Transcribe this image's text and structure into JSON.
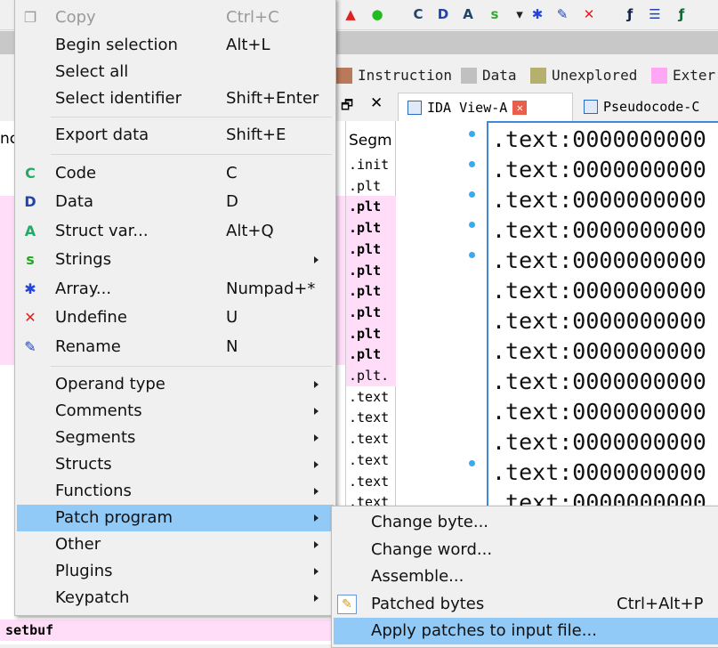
{
  "toolbar": {
    "icons": [
      "warning-icon",
      "green-circle-icon",
      "make-code-icon",
      "make-data-icon",
      "struct-var-icon",
      "strings-icon",
      "dropdown-icon",
      "array-icon",
      "rename-icon",
      "undefine-icon",
      "function-icon",
      "list-icon",
      "function-tail-icon"
    ]
  },
  "legend": [
    {
      "label": "Instruction",
      "color": "#b87a5a"
    },
    {
      "label": "Data",
      "color": "#c0c0c0"
    },
    {
      "label": "Unexplored",
      "color": "#b5b06e"
    },
    {
      "label": "Exter",
      "color": "#ffa6f4"
    }
  ],
  "tabs": [
    {
      "label": "IDA View-A"
    },
    {
      "label": "Pseudocode-C"
    }
  ],
  "left_panel": {
    "header_fragment": "nc",
    "bottom_row": "setbuf"
  },
  "segments": {
    "header": "Segm",
    "rows": [
      ".init",
      ".plt",
      ".plt",
      ".plt",
      ".plt",
      ".plt",
      ".plt",
      ".plt",
      ".plt",
      ".plt",
      ".plt.",
      ".text",
      ".text",
      ".text",
      ".text",
      ".text",
      ".text"
    ]
  },
  "ida_view": {
    "line_text": ".text:0000000000"
  },
  "context_menu": {
    "items": [
      {
        "label": "Copy",
        "shortcut": "Ctrl+C",
        "icon": "copy-icon",
        "disabled": true
      },
      {
        "label": "Begin selection",
        "shortcut": "Alt+L"
      },
      {
        "label": "Select all",
        "shortcut": ""
      },
      {
        "label": "Select identifier",
        "shortcut": "Shift+Enter"
      },
      {
        "label": "Export data",
        "shortcut": "Shift+E"
      },
      {
        "label": "Code",
        "shortcut": "C",
        "icon": "make-code-icon"
      },
      {
        "label": "Data",
        "shortcut": "D",
        "icon": "make-data-icon"
      },
      {
        "label": "Struct var...",
        "shortcut": "Alt+Q",
        "icon": "struct-var-icon"
      },
      {
        "label": "Strings",
        "shortcut": "",
        "icon": "strings-icon",
        "submenu": true
      },
      {
        "label": "Array...",
        "shortcut": "Numpad+*",
        "icon": "array-icon"
      },
      {
        "label": "Undefine",
        "shortcut": "U",
        "icon": "undefine-icon"
      },
      {
        "label": "Rename",
        "shortcut": "N",
        "icon": "rename-icon"
      },
      {
        "label": "Operand type",
        "submenu": true
      },
      {
        "label": "Comments",
        "submenu": true
      },
      {
        "label": "Segments",
        "submenu": true
      },
      {
        "label": "Structs",
        "submenu": true
      },
      {
        "label": "Functions",
        "submenu": true
      },
      {
        "label": "Patch program",
        "submenu": true,
        "highlighted": true
      },
      {
        "label": "Other",
        "submenu": true
      },
      {
        "label": "Plugins",
        "submenu": true
      },
      {
        "label": "Keypatch",
        "submenu": true
      }
    ]
  },
  "patch_submenu": {
    "items": [
      {
        "label": "Change byte...",
        "shortcut": ""
      },
      {
        "label": "Change word...",
        "shortcut": ""
      },
      {
        "label": "Assemble...",
        "shortcut": ""
      },
      {
        "label": "Patched bytes",
        "shortcut": "Ctrl+Alt+P",
        "icon": "patched-bytes-icon"
      },
      {
        "label": "Apply patches to input file...",
        "shortcut": "",
        "highlighted": true
      }
    ]
  },
  "colors": {
    "highlight": "#91c9f7",
    "menu_bg": "#f0f0f0",
    "pink_row": "#ffddf8",
    "accent": "#3c8ad8"
  }
}
